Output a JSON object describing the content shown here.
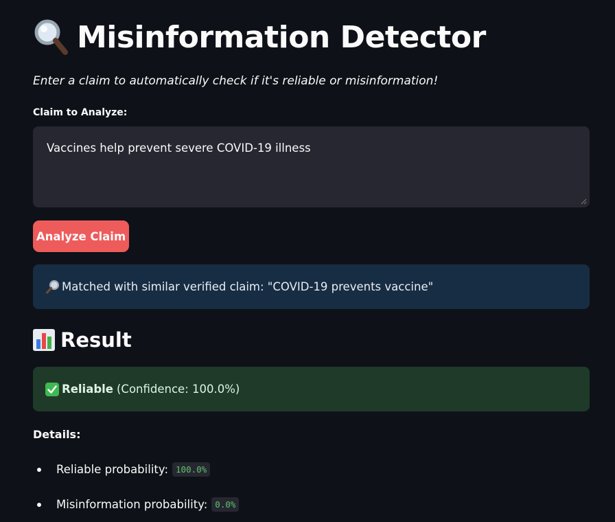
{
  "header": {
    "title": "Misinformation Detector",
    "subtitle": "Enter a claim to automatically check if it's reliable or misinformation!"
  },
  "claim_input": {
    "label": "Claim to Analyze:",
    "value": "Vaccines help prevent severe COVID-19 illness"
  },
  "analyze_button": {
    "label": "Analyze Claim"
  },
  "info_box": {
    "text": "Matched with similar verified claim: \"COVID-19 prevents vaccine\""
  },
  "result": {
    "heading": "Result",
    "verdict": "Reliable",
    "confidence_text": "(Confidence: 100.0%)"
  },
  "details": {
    "label": "Details:",
    "items": [
      {
        "label": "Reliable probability:",
        "value": "100.0%"
      },
      {
        "label": "Misinformation probability:",
        "value": "0.0%"
      }
    ]
  },
  "icons": {
    "title_icon": "magnifying-glass-icon",
    "info_icon": "magnifying-glass-right-icon",
    "result_icon": "bar-chart-icon",
    "verdict_icon": "check-mark-icon"
  },
  "colors": {
    "background": "#0e1117",
    "input_bg": "#262730",
    "primary_button": "#ee5b5b",
    "info_bg": "#172d43",
    "success_bg": "#1f3a29",
    "code_text": "#5ec46e"
  }
}
